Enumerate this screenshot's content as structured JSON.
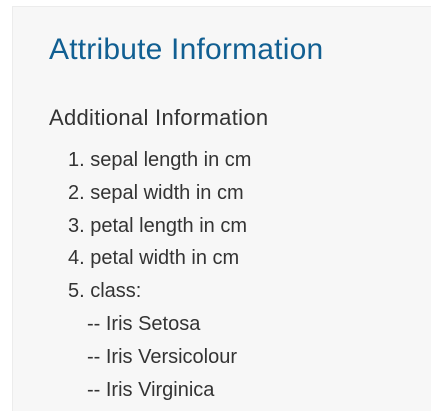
{
  "heading": "Attribute Information",
  "subheading": "Additional Information",
  "attributes": [
    "1. sepal length in cm",
    "2. sepal width in cm",
    "3. petal length in cm",
    "4. petal width in cm",
    "5. class:"
  ],
  "classes": [
    "-- Iris Setosa",
    "-- Iris Versicolour",
    "-- Iris Virginica"
  ]
}
